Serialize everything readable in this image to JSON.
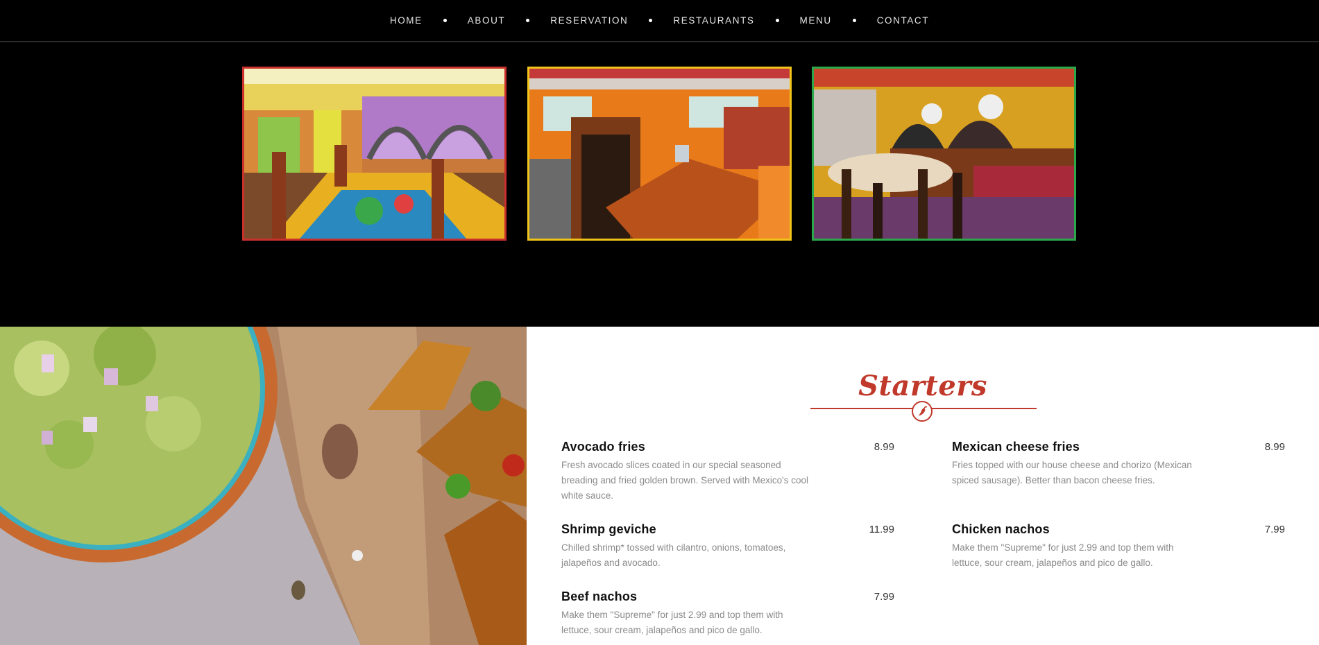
{
  "nav": {
    "items": [
      {
        "label": "HOME"
      },
      {
        "label": "ABOUT"
      },
      {
        "label": "RESERVATION"
      },
      {
        "label": "RESTAURANTS"
      },
      {
        "label": "MENU"
      },
      {
        "label": "CONTACT"
      }
    ]
  },
  "gallery": {
    "frame_colors": [
      "#c9302c",
      "#f0c419",
      "#2aa84a"
    ]
  },
  "menu": {
    "heading": "Starters",
    "accent_color": "#c0392b",
    "divider_icon": "chili-pepper-icon",
    "items": [
      {
        "name": "Avocado fries",
        "price": "8.99",
        "description": "Fresh avocado slices coated in our special seasoned breading and fried golden brown. Served with Mexico's cool white sauce."
      },
      {
        "name": "Mexican cheese fries",
        "price": "8.99",
        "description": "Fries topped with our house cheese and chorizo (Mexican spiced sausage). Better than bacon cheese fries."
      },
      {
        "name": "Shrimp geviche",
        "price": "11.99",
        "description": "Chilled shrimp* tossed with cilantro, onions, tomatoes, jalapeños and avocado."
      },
      {
        "name": "Chicken nachos",
        "price": "7.99",
        "description": "Make them \"Supreme\" for just 2.99 and top them with lettuce, sour cream, jalapeños and pico de gallo."
      },
      {
        "name": "Beef nachos",
        "price": "7.99",
        "description": "Make them \"Supreme\" for just 2.99 and top them with lettuce, sour cream, jalapeños and pico de gallo."
      }
    ]
  }
}
